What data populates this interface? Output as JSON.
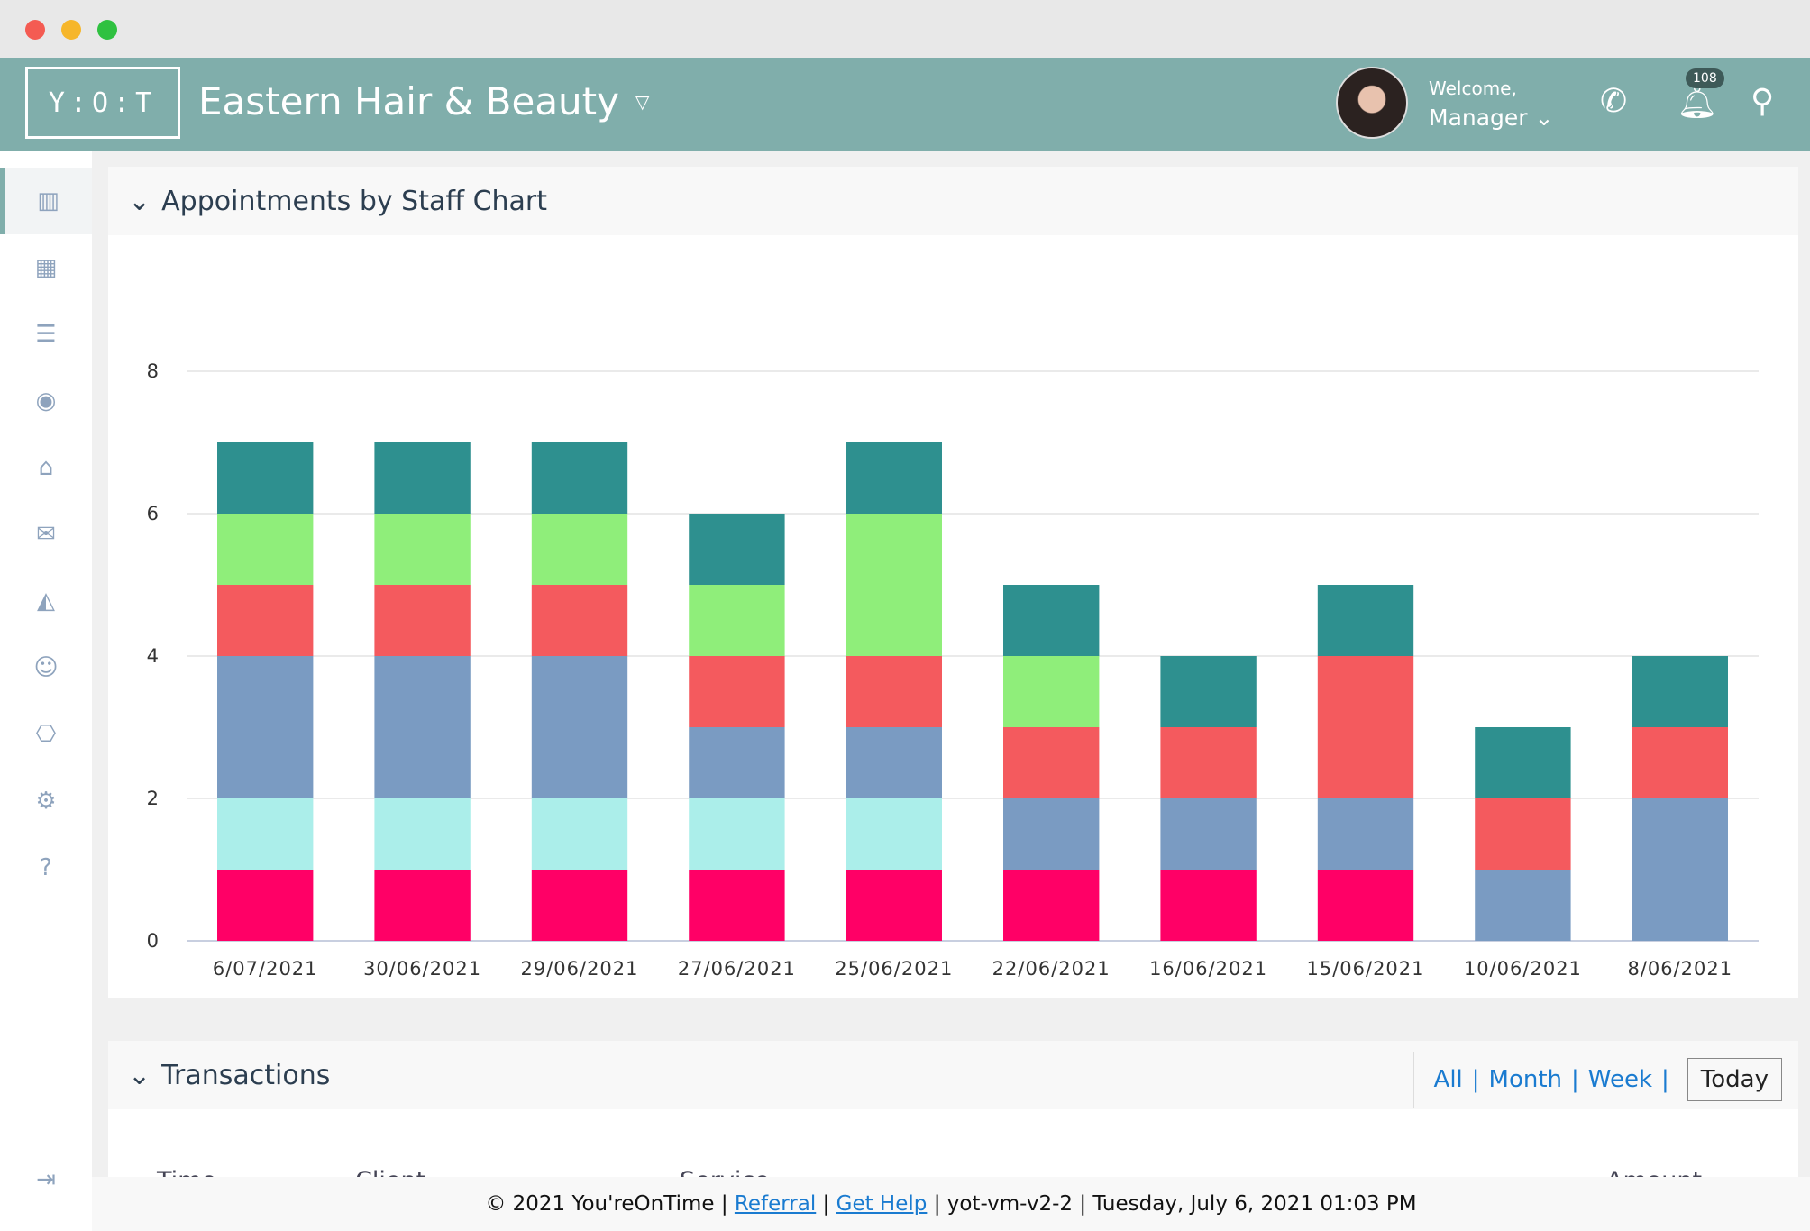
{
  "window": {
    "controls": [
      "close",
      "minimize",
      "maximize"
    ]
  },
  "header": {
    "logo": "Y:O:T",
    "business": "Eastern Hair & Beauty",
    "welcome": "Welcome,",
    "user": "Manager",
    "notifications": "108",
    "icons": [
      "phone-icon",
      "bell-icon",
      "search-icon"
    ]
  },
  "sidebar": {
    "items": [
      "bar-chart-icon",
      "calendar-icon",
      "receipt-icon",
      "user-circle-icon",
      "inbox-icon",
      "mail-icon",
      "area-chart-icon",
      "users-icon",
      "gift-icon",
      "gear-icon",
      "help-icon"
    ],
    "bottom": "logout-icon"
  },
  "chart_panel": {
    "title": "Appointments by Staff Chart"
  },
  "chart_data": {
    "type": "bar",
    "stacked": true,
    "categories": [
      "6/07/2021",
      "30/06/2021",
      "29/06/2021",
      "27/06/2021",
      "25/06/2021",
      "22/06/2021",
      "16/06/2021",
      "15/06/2021",
      "10/06/2021",
      "8/06/2021"
    ],
    "series": [
      {
        "color": "#ff0066",
        "values": [
          1,
          1,
          1,
          1,
          1,
          1,
          1,
          1,
          0,
          0
        ]
      },
      {
        "color": "#abeeea",
        "values": [
          1,
          1,
          1,
          1,
          1,
          0,
          0,
          0,
          0,
          0
        ]
      },
      {
        "color": "#7a9bc2",
        "values": [
          2,
          2,
          2,
          1,
          1,
          1,
          1,
          1,
          1,
          2
        ]
      },
      {
        "color": "#f45a5e",
        "values": [
          1,
          1,
          1,
          1,
          1,
          1,
          1,
          2,
          1,
          1
        ]
      },
      {
        "color": "#8fee7a",
        "values": [
          1,
          1,
          1,
          1,
          2,
          1,
          0,
          0,
          0,
          0
        ]
      },
      {
        "color": "#2e908f",
        "values": [
          1,
          1,
          1,
          1,
          1,
          1,
          1,
          1,
          1,
          1
        ]
      }
    ],
    "yticks": [
      "0",
      "2",
      "4",
      "6",
      "8"
    ],
    "ylim": [
      0,
      8
    ],
    "grid": true
  },
  "transactions": {
    "title": "Transactions",
    "filters": [
      "All",
      "Month",
      "Week"
    ],
    "selected": "Today",
    "columns": [
      "Time",
      "Client",
      "Service",
      "Amount"
    ]
  },
  "footer": {
    "copyright": "© 2021 You'reOnTime |",
    "referral": "Referral",
    "help": "Get Help",
    "rest": "| yot-vm-v2-2 | Tuesday, July 6, 2021 01:03 PM"
  }
}
